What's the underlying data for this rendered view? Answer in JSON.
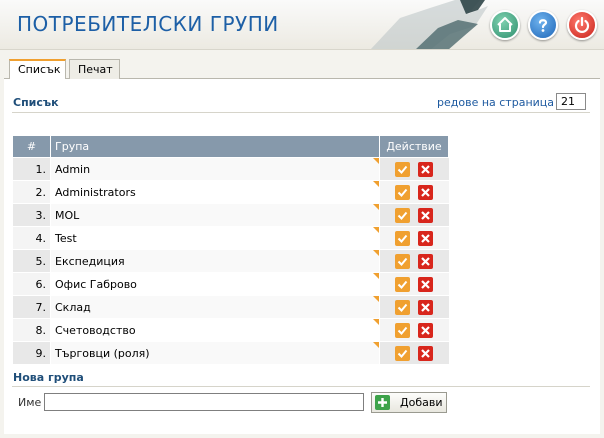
{
  "header": {
    "title": "ПОТРЕБИТЕЛСКИ ГРУПИ",
    "buttons": [
      {
        "icon": "home-icon",
        "color": "#2f8f6e"
      },
      {
        "icon": "help-icon",
        "color": "#1e66b8"
      },
      {
        "icon": "power-icon",
        "color": "#c8231b"
      }
    ]
  },
  "tabs": [
    {
      "label": "Списък",
      "active": true
    },
    {
      "label": "Печат",
      "active": false
    }
  ],
  "list": {
    "title": "Списък",
    "rows_per_page_label": "редове на страница",
    "rows_per_page_arrow": "»",
    "rows_per_page_value": "21"
  },
  "table": {
    "columns": [
      "#",
      "Група",
      "Действие"
    ],
    "rows": [
      {
        "num": "1.",
        "name": "Admin"
      },
      {
        "num": "2.",
        "name": "Administrators"
      },
      {
        "num": "3.",
        "name": "MOL"
      },
      {
        "num": "4.",
        "name": "Test"
      },
      {
        "num": "5.",
        "name": "Експедиция"
      },
      {
        "num": "6.",
        "name": "Офис Габрово"
      },
      {
        "num": "7.",
        "name": "Склад"
      },
      {
        "num": "8.",
        "name": "Счетоводство"
      },
      {
        "num": "9.",
        "name": "Търговци (роля)"
      }
    ],
    "edit_color": "#f0a030",
    "delete_color": "#d8261c"
  },
  "new_group": {
    "title": "Нова група",
    "name_label": "Име",
    "name_value": "",
    "add_label": "Добави"
  }
}
